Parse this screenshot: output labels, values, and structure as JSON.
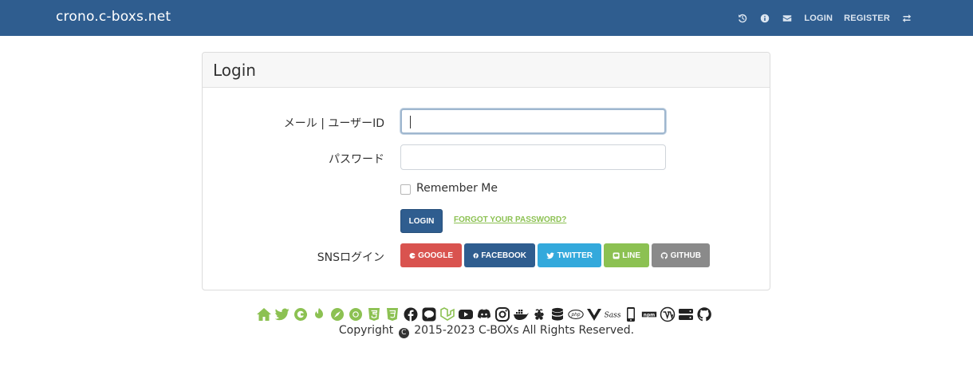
{
  "navbar": {
    "brand": "crono.c-boxs.net",
    "icons": [
      "history-icon",
      "info-icon",
      "envelope-icon"
    ],
    "login_label": "LOGIN",
    "register_label": "REGISTER",
    "switch_icon": "exchange-icon"
  },
  "card": {
    "title": "Login",
    "email_label": "メール | ユーザーID",
    "email_value": "",
    "password_label": "パスワード",
    "password_value": "",
    "remember_label": "Remember Me",
    "login_button": "LOGIN",
    "forgot_link": "FORGOT YOUR PASSWORD?",
    "sns_label": "SNSログイン",
    "sns_buttons": [
      {
        "label": "GOOGLE",
        "icon": "google-icon",
        "color": "#d9534f"
      },
      {
        "label": "FACEBOOK",
        "icon": "facebook-icon",
        "color": "#2f5d8f"
      },
      {
        "label": "TWITTER",
        "icon": "twitter-icon",
        "color": "#33a9dc"
      },
      {
        "label": "LINE",
        "icon": "line-icon",
        "color": "#8cc152"
      },
      {
        "label": "GITHUB",
        "icon": "github-icon",
        "color": "#8a8a8a"
      }
    ]
  },
  "footer": {
    "icons": [
      "home-icon",
      "twitter-icon",
      "google-icon",
      "pixiv-icon",
      "compass-icon",
      "chrome-icon",
      "html5-icon",
      "css3-icon",
      "facebook-icon",
      "line-icon",
      "laravel-icon",
      "youtube-icon",
      "discord-icon",
      "instagram-icon",
      "docker-icon",
      "raspberry-icon",
      "database-icon",
      "php-icon",
      "vuejs-icon",
      "sass-icon",
      "mobile-icon",
      "npm-icon",
      "wordpress-icon",
      "server-icon",
      "github-icon"
    ],
    "copyright_prefix": "Copyright",
    "copyright_symbol": "C",
    "copyright_text": "2015-2023 C-BOXs All Rights Reserved."
  },
  "colors": {
    "navbar": "#2f5d8f",
    "accent_green": "#8cc152",
    "footer_icon_dark": "#222222"
  }
}
